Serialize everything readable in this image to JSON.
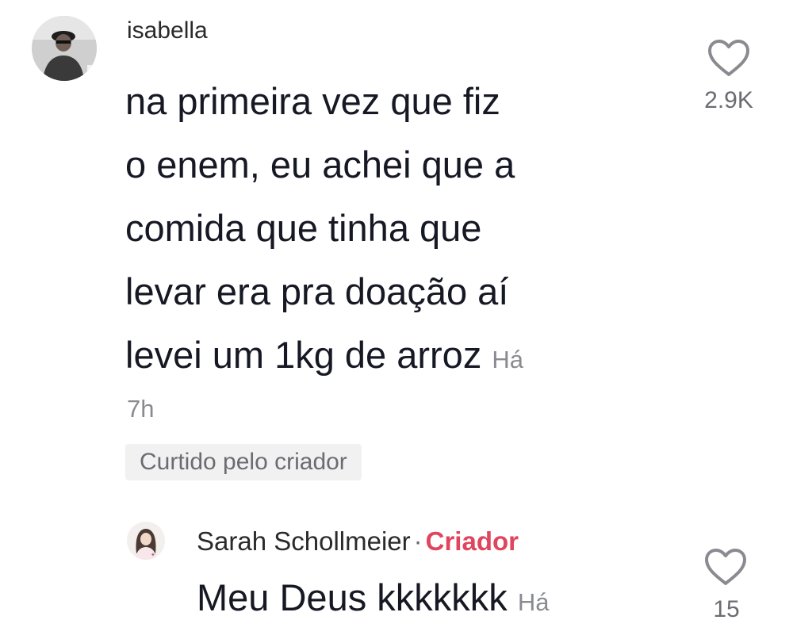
{
  "comment": {
    "username": "isabella",
    "lines": [
      "na primeira vez que fiz",
      "o enem, eu achei que a",
      "comida que tinha que",
      "levar era pra doação aí",
      "levei um 1kg de arroz"
    ],
    "time_prefix": "Há",
    "time_value": "7h",
    "liked_by_creator": "Curtido pelo criador",
    "likes": "2.9K",
    "icons": {
      "avatar": "user-avatar-icon",
      "like": "heart-outline-icon"
    }
  },
  "reply": {
    "username": "Sarah Schollmeier",
    "separator": "·",
    "role_tag": "Criador",
    "text": "Meu Deus kkkkkkk",
    "time_prefix": "Há",
    "likes": "15",
    "icons": {
      "avatar": "creator-avatar-icon",
      "like": "heart-outline-icon"
    }
  },
  "colors": {
    "text": "#161823",
    "secondary": "#8a8b91",
    "creator_accent": "#e0455e",
    "badge_bg": "#f1f1f2"
  }
}
